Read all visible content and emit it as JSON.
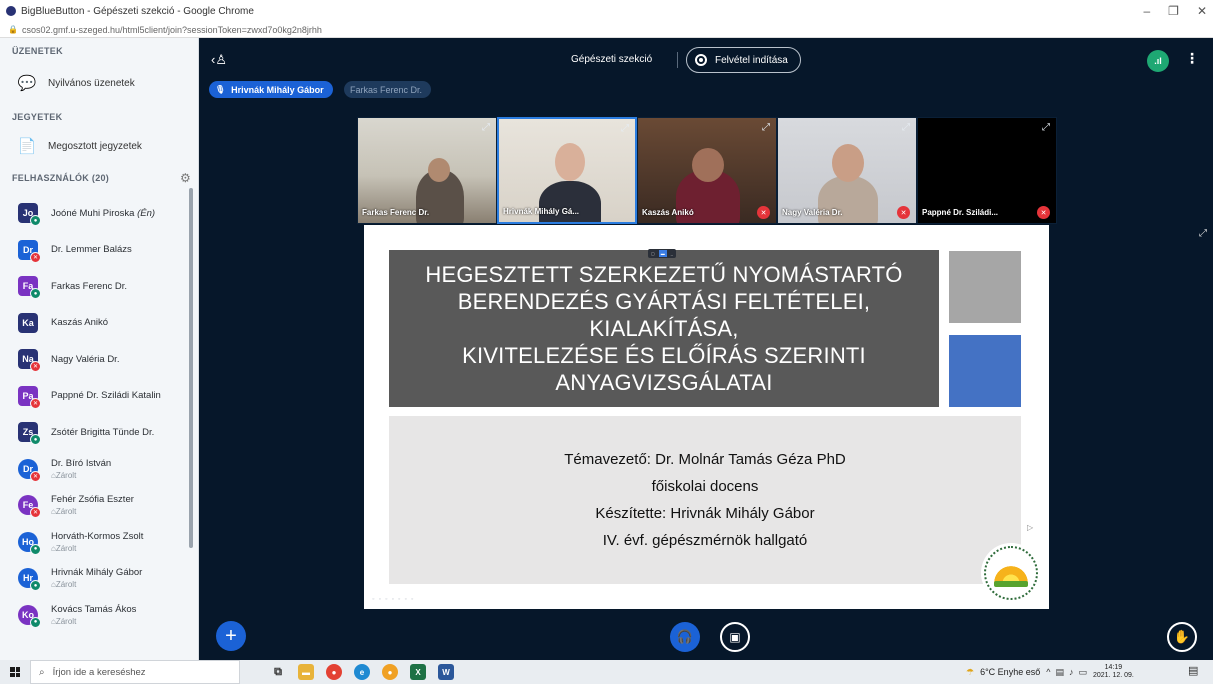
{
  "window": {
    "title": "BigBlueButton - Gépészeti szekció - Google Chrome",
    "url": "csos02.gmf.u-szeged.hu/html5client/join?sessionToken=zwxd7o0kg2n8jrhh"
  },
  "sidebar": {
    "messages_title": "ÜZENETEK",
    "public_chat": "Nyilvános üzenetek",
    "notes_title": "JEGYETEK",
    "shared_notes": "Megosztott jegyzetek",
    "users_title": "FELHASZNÁLÓK (20)",
    "users": [
      {
        "initials": "Jo",
        "name": "Joóné Muhi Piroska",
        "suffix": "(Én)",
        "color": "#283274",
        "shape": "square",
        "status": "mic",
        "locked": ""
      },
      {
        "initials": "Dr",
        "name": "Dr. Lemmer Balázs",
        "suffix": "",
        "color": "#1b62d6",
        "shape": "square",
        "status": "muted",
        "locked": ""
      },
      {
        "initials": "Fa",
        "name": "Farkas Ferenc Dr.",
        "suffix": "",
        "color": "#7a33c2",
        "shape": "square",
        "status": "mic",
        "locked": ""
      },
      {
        "initials": "Ka",
        "name": "Kaszás Anikó",
        "suffix": "",
        "color": "#283274",
        "shape": "square",
        "status": "",
        "locked": ""
      },
      {
        "initials": "Na",
        "name": "Nagy Valéria Dr.",
        "suffix": "",
        "color": "#283274",
        "shape": "square",
        "status": "muted",
        "locked": ""
      },
      {
        "initials": "Pa",
        "name": "Pappné Dr. Sziládi Katalin",
        "suffix": "",
        "color": "#7a33c2",
        "shape": "square",
        "status": "muted",
        "locked": ""
      },
      {
        "initials": "Zs",
        "name": "Zsótér Brigitta Tünde Dr.",
        "suffix": "",
        "color": "#283274",
        "shape": "square",
        "status": "mic",
        "locked": ""
      },
      {
        "initials": "Dr",
        "name": "Dr. Bíró István",
        "suffix": "",
        "color": "#1b62d6",
        "shape": "round",
        "status": "muted",
        "locked": "Zárolt"
      },
      {
        "initials": "Fe",
        "name": "Fehér Zsófia Eszter",
        "suffix": "",
        "color": "#7a33c2",
        "shape": "round",
        "status": "muted",
        "locked": "Zárolt"
      },
      {
        "initials": "Ho",
        "name": "Horváth-Kormos Zsolt",
        "suffix": "",
        "color": "#1b62d6",
        "shape": "round",
        "status": "mic",
        "locked": "Zárolt"
      },
      {
        "initials": "Hr",
        "name": "Hrivnák Mihály Gábor",
        "suffix": "",
        "color": "#1b62d6",
        "shape": "round",
        "status": "mic",
        "locked": "Zárolt"
      },
      {
        "initials": "Ko",
        "name": "Kovács Tamás Ákos",
        "suffix": "",
        "color": "#7a33c2",
        "shape": "round",
        "status": "mic",
        "locked": "Zárolt"
      }
    ]
  },
  "header": {
    "meeting_name": "Gépészeti szekció",
    "record_label": "Felvétel indítása",
    "connection": ".ıl"
  },
  "talkers": {
    "active": "Hrivnák Mihály Gábor",
    "inactive": "Farkas Ferenc Dr."
  },
  "webcams": [
    {
      "name": "Farkas Ferenc Dr.",
      "muted": false
    },
    {
      "name": "Hrivnák Mihály Gá...",
      "muted": false
    },
    {
      "name": "Kaszás Anikó",
      "muted": true
    },
    {
      "name": "Nagy Valéria Dr.",
      "muted": true
    },
    {
      "name": "Pappné Dr. Sziládi...",
      "muted": true
    }
  ],
  "slide": {
    "title_lines": [
      "HEGESZTETT SZERKEZETŰ NYOMÁSTARTÓ",
      "BERENDEZÉS GYÁRTÁSI FELTÉTELEI, KIALAKÍTÁSA,",
      "KIVITELEZÉSE ÉS ELŐÍRÁS SZERINTI",
      "ANYAGVIZSGÁLATAI"
    ],
    "info_lines": [
      "Témavezető: Dr. Molnár Tamás Géza PhD",
      "főiskolai docens",
      "Készítette: Hrivnák Mihály Gábor",
      "IV. évf. gépészmérnök hallgató"
    ]
  },
  "taskbar": {
    "search_placeholder": "Írjon ide a kereséshez",
    "weather": "6°C Enyhe eső",
    "time": "14:19",
    "date": "2021. 12. 09."
  }
}
